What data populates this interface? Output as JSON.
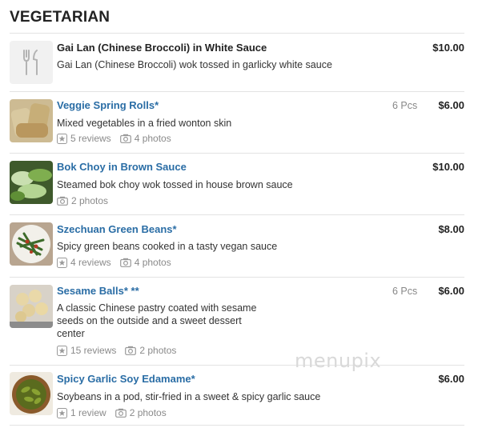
{
  "section": {
    "title": "VEGETARIAN"
  },
  "items": [
    {
      "name": "Gai Lan (Chinese Broccoli) in White Sauce",
      "description": "Gai Lan (Chinese Broccoli) wok tossed in garlicky white sauce",
      "price": "$10.00"
    },
    {
      "name": "Veggie Spring Rolls*",
      "quantity": "6 Pcs",
      "description": "Mixed vegetables in a fried wonton skin",
      "price": "$6.00",
      "reviews": "5 reviews",
      "photos": "4 photos"
    },
    {
      "name": "Bok Choy in Brown Sauce",
      "description": "Steamed bok choy wok tossed in house brown sauce",
      "price": "$10.00",
      "photos": "2 photos"
    },
    {
      "name": "Szechuan Green Beans*",
      "description": "Spicy green beans cooked in a tasty vegan sauce",
      "price": "$8.00",
      "reviews": "4 reviews",
      "photos": "4 photos"
    },
    {
      "name": "Sesame Balls* **",
      "quantity": "6 Pcs",
      "description": "A classic Chinese pastry coated with sesame seeds on the outside and a sweet dessert center",
      "price": "$6.00",
      "reviews": "15 reviews",
      "photos": "2 photos"
    },
    {
      "name": "Spicy Garlic Soy Edamame*",
      "description": "Soybeans in a pod, stir-fried in a sweet & spicy garlic sauce",
      "price": "$6.00",
      "reviews": "1 review",
      "photos": "2 photos"
    }
  ],
  "watermark": "menupix",
  "icons": [
    "fork-knife-icon",
    "star-icon",
    "camera-icon"
  ]
}
